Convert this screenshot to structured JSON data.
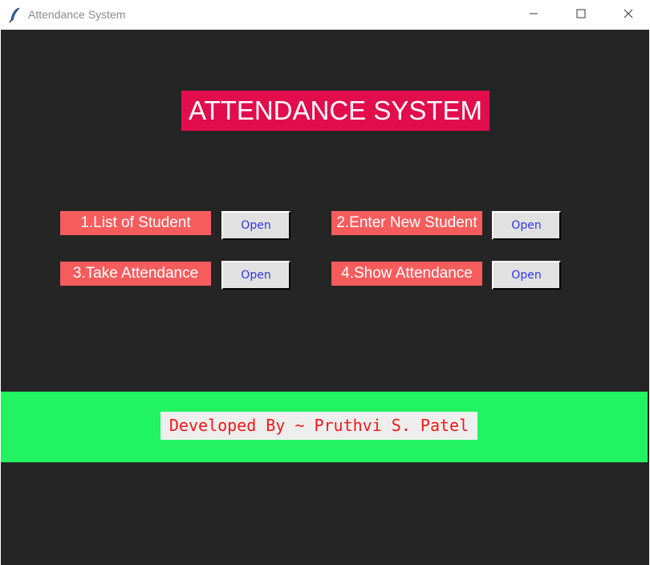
{
  "window": {
    "title": "Attendance System",
    "icon": "feather-icon",
    "controls": [
      "minimize-icon",
      "maximize-icon",
      "close-icon"
    ]
  },
  "main": {
    "heading": "ATTENDANCE SYSTEM",
    "options": [
      {
        "label": "1.List of Student",
        "button": "Open"
      },
      {
        "label": "2.Enter New Student",
        "button": "Open"
      },
      {
        "label": "3.Take Attendance",
        "button": "Open"
      },
      {
        "label": "4.Show Attendance",
        "button": "Open"
      }
    ]
  },
  "footer": {
    "credit": "Developed By ~ Pruthvi S. Patel"
  },
  "colors": {
    "background": "#262525",
    "heading_bg": "#e20d4d",
    "label_bg": "#f75c5c",
    "button_bg": "#e1e1e1",
    "button_text": "#3434e6",
    "footer_bg": "#22f461",
    "credit_text": "#f21818"
  }
}
